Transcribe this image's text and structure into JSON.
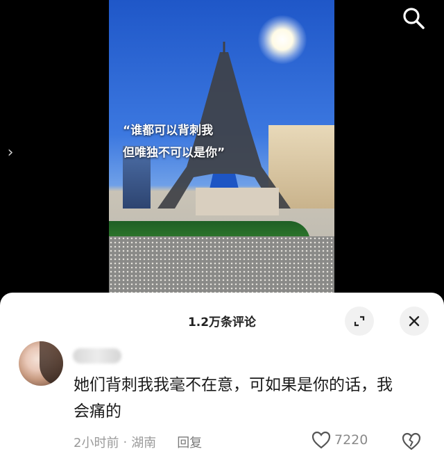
{
  "video": {
    "caption": "“谁都可以背刺我\n但唯独不可以是你”"
  },
  "toolbar": {
    "search_icon": "search-icon",
    "side_arrow_icon": "chevron-right-icon",
    "side_arrow_glyph": "›"
  },
  "comments": {
    "title": "1.2万条评论",
    "expand_icon": "expand-icon",
    "close_icon": "close-icon",
    "items": [
      {
        "text": "她们背刺我我毫不在意，可如果是你的话，我会痛的",
        "time": "2小时前",
        "separator": "·",
        "location": "湖南",
        "reply_label": "回复",
        "like_count": "7220",
        "like_icon": "heart-outline-icon",
        "dislike_icon": "broken-heart-icon"
      }
    ]
  }
}
